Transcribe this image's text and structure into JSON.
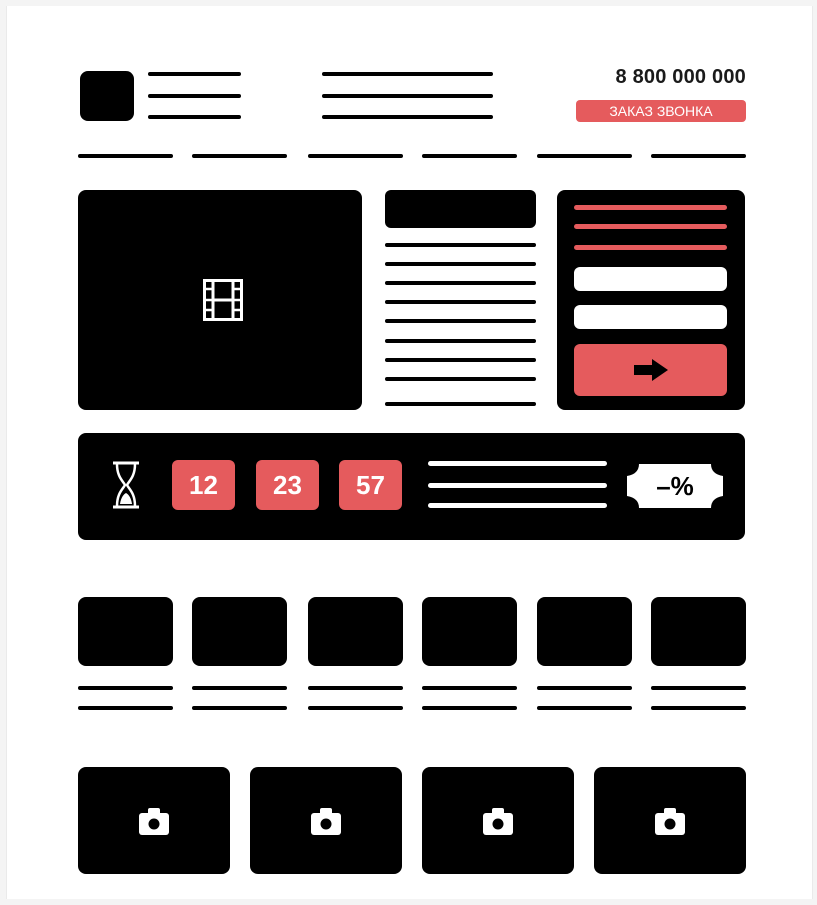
{
  "header": {
    "phone": "8 800 000 000",
    "callback_label": "ЗАКАЗ ЗВОНКА"
  },
  "timer": {
    "hours": "12",
    "minutes": "23",
    "seconds": "57",
    "discount_label": "–%"
  },
  "icons": {
    "logo": "logo-block",
    "video": "film-icon",
    "submit": "arrow-right-icon",
    "timer": "hourglass-icon",
    "discount": "discount-tag-icon",
    "photo": "camera-icon"
  },
  "colors": {
    "accent": "#e55b5d",
    "dark": "#000000",
    "background": "#ffffff"
  }
}
